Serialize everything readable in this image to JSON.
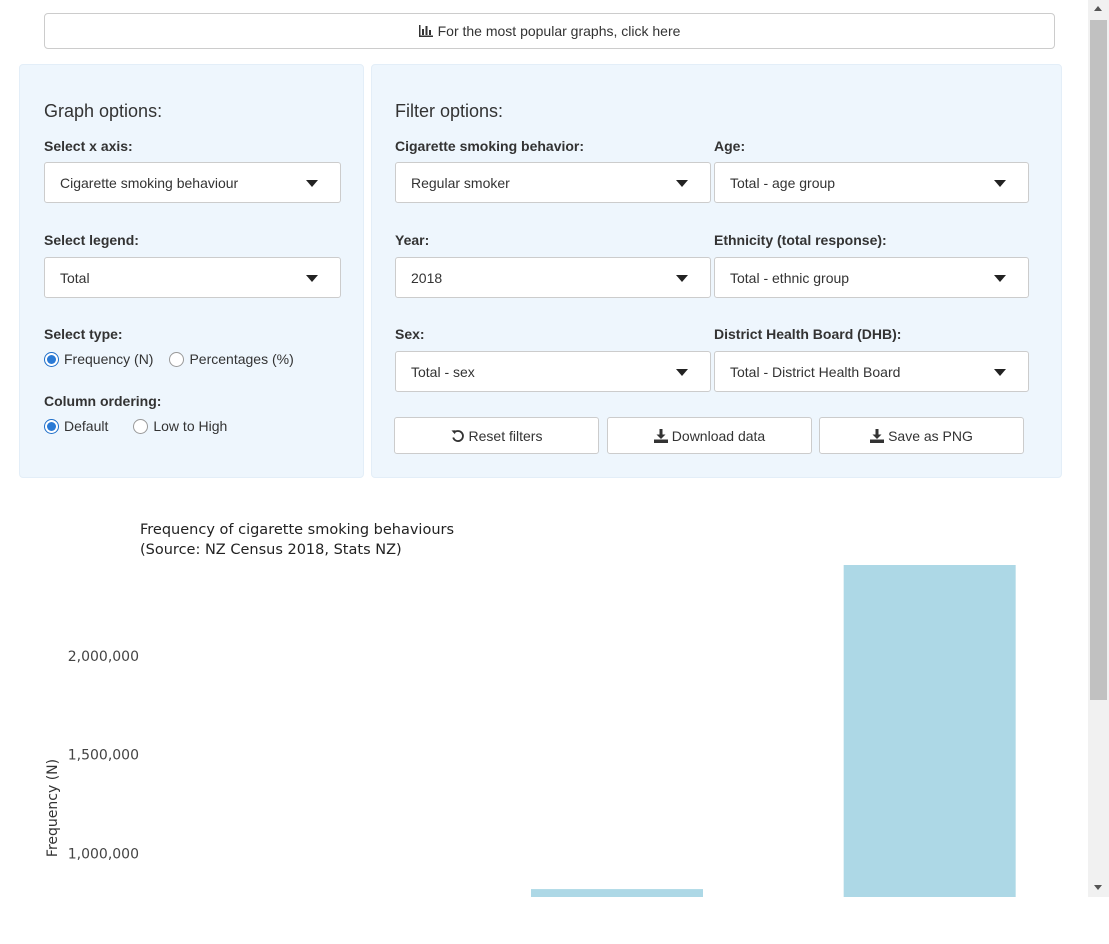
{
  "top_button": {
    "label": "For the most popular graphs, click here",
    "icon": "bar-chart-icon"
  },
  "graph_options": {
    "title": "Graph options:",
    "x_axis": {
      "label": "Select x axis:",
      "value": "Cigarette smoking behaviour"
    },
    "legend": {
      "label": "Select legend:",
      "value": "Total"
    },
    "type": {
      "label": "Select type:",
      "options": [
        "Frequency (N)",
        "Percentages (%)"
      ],
      "selected": "Frequency (N)"
    },
    "ordering": {
      "label": "Column ordering:",
      "options": [
        "Default",
        "Low to High"
      ],
      "selected": "Default"
    }
  },
  "filter_options": {
    "title": "Filter options:",
    "smoking": {
      "label": "Cigarette smoking behavior:",
      "value": "Regular smoker"
    },
    "age": {
      "label": "Age:",
      "value": "Total - age group"
    },
    "year": {
      "label": "Year:",
      "value": "2018"
    },
    "ethnicity": {
      "label": "Ethnicity (total response):",
      "value": "Total - ethnic group"
    },
    "sex": {
      "label": "Sex:",
      "value": "Total - sex"
    },
    "dhb": {
      "label": "District Health Board (DHB):",
      "value": "Total - District Health Board"
    },
    "buttons": {
      "reset": "Reset filters",
      "download": "Download data",
      "save": "Save as PNG"
    }
  },
  "chart_data": {
    "type": "bar",
    "title": "Frequency of cigarette smoking behaviours",
    "subtitle": "(Source: NZ Census 2018, Stats NZ)",
    "xlabel": "",
    "ylabel": "Frequency (N)",
    "categories": [
      "",
      "",
      ""
    ],
    "values": [
      null,
      820000,
      2460000
    ],
    "ylim": [
      780000,
      2460000
    ],
    "yticks": [
      1000000,
      1500000,
      2000000
    ],
    "ytick_labels": [
      "1,000,000",
      "1,500,000",
      "2,000,000"
    ],
    "color": "#add8e6"
  }
}
